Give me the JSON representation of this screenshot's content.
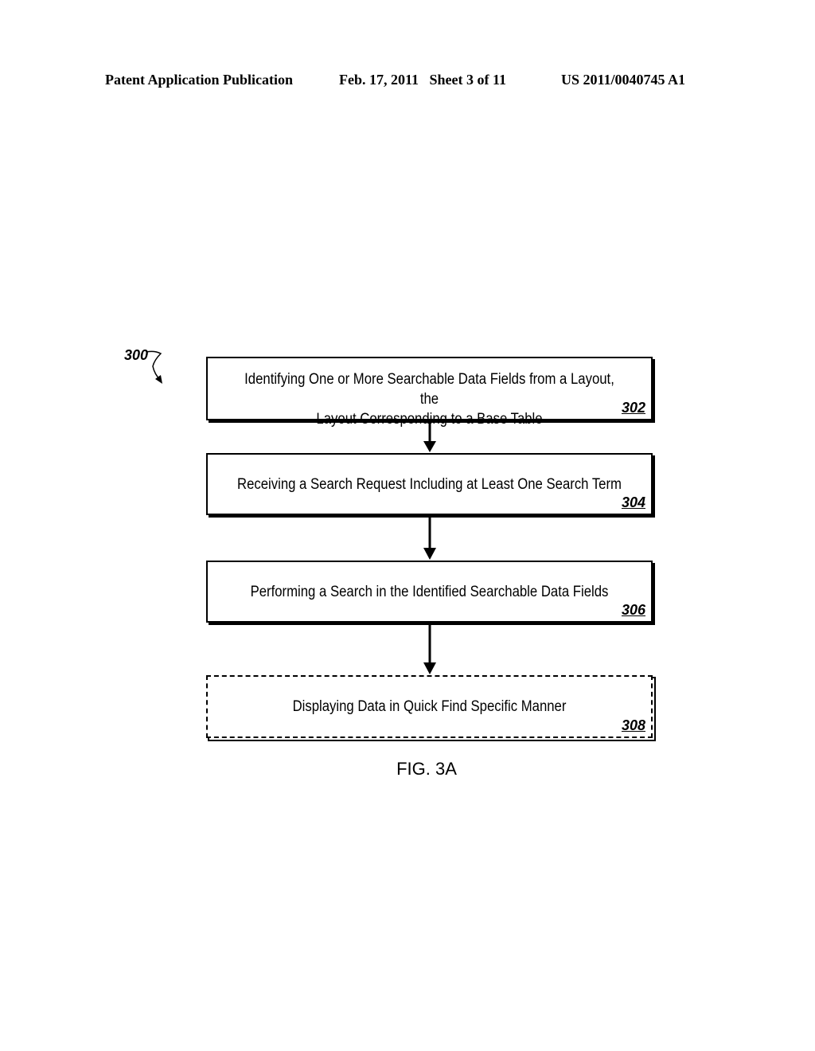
{
  "header": {
    "publication_type": "Patent Application Publication",
    "date_sheet": "Feb. 17, 2011   Sheet 3 of 11",
    "patent_number": "US 2011/0040745 A1"
  },
  "figure": {
    "reference": "300",
    "caption": "FIG. 3A",
    "steps": [
      {
        "id": "302",
        "line1": "Identifying One or More Searchable Data Fields from a Layout, the",
        "line2": "Layout Corresponding to a Base Table",
        "style": "solid"
      },
      {
        "id": "304",
        "line1": "Receiving a Search Request Including at Least One Search Term",
        "line2": "",
        "style": "solid"
      },
      {
        "id": "306",
        "line1": "Performing a Search in the Identified Searchable Data Fields",
        "line2": "",
        "style": "solid"
      },
      {
        "id": "308",
        "line1": "Displaying Data in Quick Find Specific Manner",
        "line2": "",
        "style": "dashed"
      }
    ],
    "connections": [
      {
        "from": "302",
        "to": "304"
      },
      {
        "from": "304",
        "to": "306"
      },
      {
        "from": "306",
        "to": "308"
      }
    ]
  }
}
